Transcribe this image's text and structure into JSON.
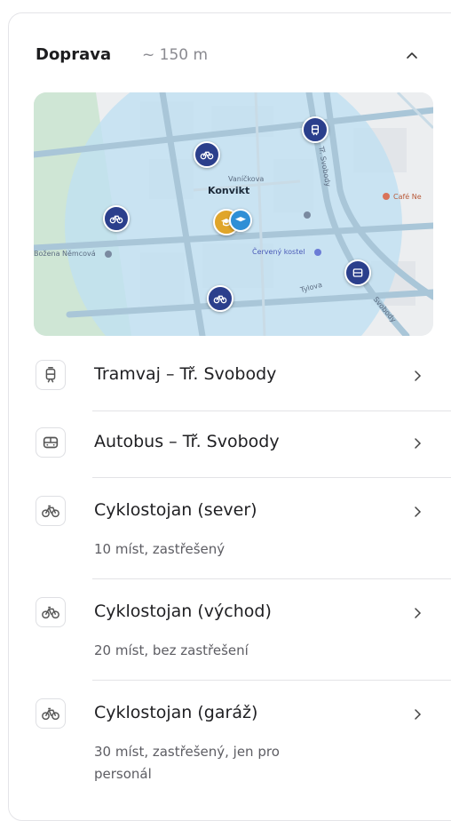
{
  "header": {
    "title": "Doprava",
    "distance": "~ 150 m",
    "collapse_icon": "chevron-up-icon"
  },
  "map": {
    "labels": {
      "konvikt": "Konvikt",
      "vanickova": "Vaníčkova",
      "cafe": "Café Ne",
      "nemcova": "Božena Němcová",
      "cerveny_kostel": "Červený kostel",
      "tr_svobody": "Tř. Svobody",
      "tylova": "Tylova",
      "svobody": "Svobody"
    },
    "colors": {
      "radius_fill": "#bfe0f2",
      "park_fill": "#cfe6d5",
      "pin": "#2b3f8c",
      "school_pin": "#e0a52a",
      "school_pin_2": "#2f8fd6"
    }
  },
  "items": [
    {
      "icon": "tram-icon",
      "label": "Tramvaj – Tř. Svobody",
      "sub": ""
    },
    {
      "icon": "bus-icon",
      "label": "Autobus – Tř. Svobody",
      "sub": ""
    },
    {
      "icon": "bicycle-icon",
      "label": "Cyklostojan (sever)",
      "sub": "10 míst, zastřešený"
    },
    {
      "icon": "bicycle-icon",
      "label": "Cyklostojan (východ)",
      "sub": "20 míst, bez zastřešení"
    },
    {
      "icon": "bicycle-icon",
      "label": "Cyklostojan (garáž)",
      "sub": "30 míst, zastřešený, jen pro personál"
    }
  ]
}
